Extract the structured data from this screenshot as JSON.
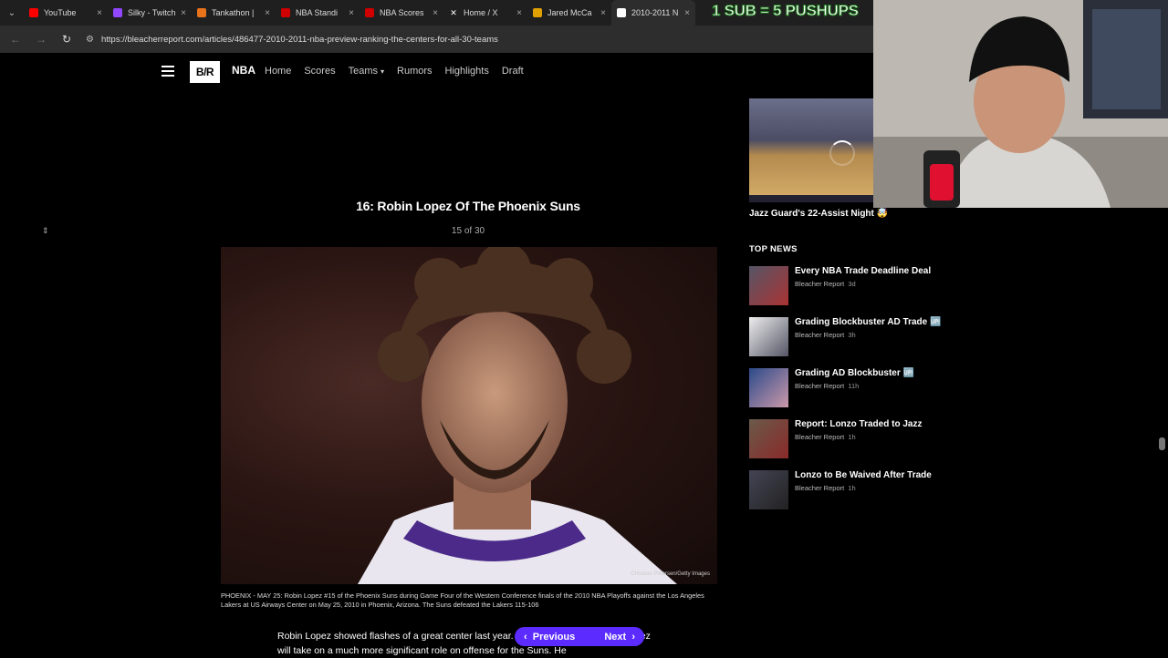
{
  "browser": {
    "tabs": [
      {
        "title": "YouTube",
        "color": "#ff0000"
      },
      {
        "title": "Silky - Twitch",
        "color": "#9146ff"
      },
      {
        "title": "Tankathon |",
        "color": "#e8731a"
      },
      {
        "title": "NBA Standi",
        "color": "#d00000"
      },
      {
        "title": "NBA Scores",
        "color": "#d00000"
      },
      {
        "title": "Home / X",
        "color": "#ffffff"
      },
      {
        "title": "Jared McCa",
        "color": "#e0a000"
      },
      {
        "title": "2010-2011 N",
        "color": "#ffffff"
      }
    ],
    "close_glyph": "×",
    "url": "https://bleacherreport.com/articles/486477-2010-2011-nba-preview-ranking-the-centers-for-all-30-teams"
  },
  "site": {
    "logo": "B/R",
    "league": "NBA",
    "nav": [
      "Home",
      "Scores",
      "Teams",
      "Rumors",
      "Highlights",
      "Draft"
    ]
  },
  "article": {
    "slide_title": "16: Robin Lopez Of The Phoenix Suns",
    "slide_count": "15 of 30",
    "photo_credit": "Christian Petersen/Getty Images",
    "caption": "PHOENIX - MAY 25: Robin Lopez #15 of the Phoenix Suns during Game Four of the Western Conference finals of the 2010 NBA Playoffs against the Los Angeles Lakers at US Airways Center on May 25, 2010 in Phoenix, Arizona. The Suns defeated the Lakers 115-106",
    "body": "Robin Lopez showed flashes of a great center last year. With Amar'e Stoudemire, Lopez will take on a much more significant role on offense for the Suns. He",
    "prev_label": "Previous",
    "next_label": "Next"
  },
  "sidebar": {
    "video_title": "Jazz Guard's 22-Assist Night 🤯",
    "top_news_heading": "TOP NEWS",
    "news": [
      {
        "title": "Every NBA Trade Deadline Deal",
        "source": "Bleacher Report",
        "age": "3d"
      },
      {
        "title": "Grading Blockbuster AD Trade 🆙",
        "source": "Bleacher Report",
        "age": "3h"
      },
      {
        "title": "Grading AD Blockbuster 🆙",
        "source": "Bleacher Report",
        "age": "11h"
      },
      {
        "title": "Report: Lonzo Traded to Jazz",
        "source": "Bleacher Report",
        "age": "1h"
      },
      {
        "title": "Lonzo to Be Waived After Trade",
        "source": "Bleacher Report",
        "age": "1h"
      }
    ]
  },
  "overlay": {
    "banner": "1 SUB = 5 PUSHUPS"
  }
}
